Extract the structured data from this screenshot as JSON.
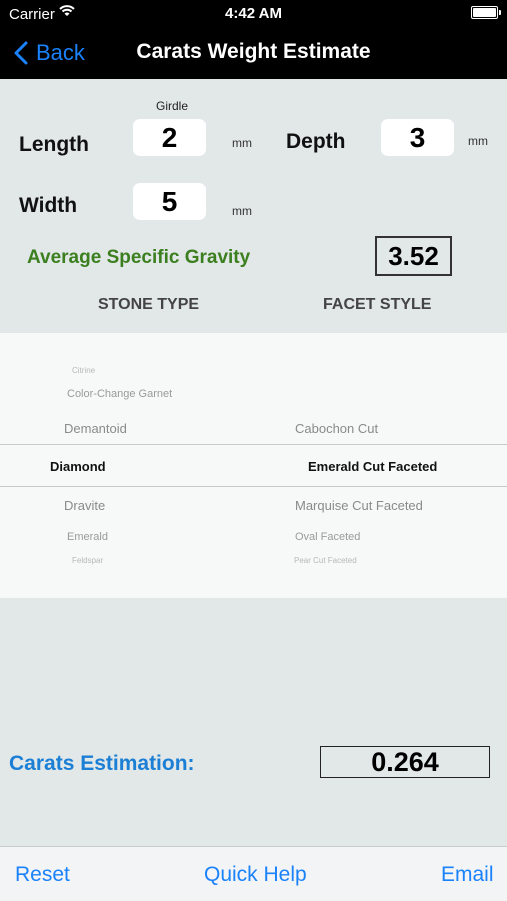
{
  "status_bar": {
    "carrier": "Carrier",
    "time": "4:42 AM"
  },
  "nav": {
    "back_label": "Back",
    "title": "Carats Weight Estimate"
  },
  "form": {
    "girdle_label": "Girdle",
    "length": {
      "label": "Length",
      "value": "2",
      "unit": "mm"
    },
    "depth": {
      "label": "Depth",
      "value": "3",
      "unit": "mm"
    },
    "width": {
      "label": "Width",
      "value": "5",
      "unit": "mm"
    },
    "specific_gravity": {
      "label": "Average Specific Gravity",
      "value": "3.52"
    }
  },
  "picker": {
    "stone_type_header": "STONE TYPE",
    "facet_style_header": "FACET STYLE",
    "stone_types": [
      "Citrine",
      "Color-Change Garnet",
      "Demantoid",
      "Diamond",
      "Dravite",
      "Emerald",
      "Feldspar"
    ],
    "stone_selected": "Diamond",
    "facet_styles": [
      "Cabochon Cut",
      "Emerald Cut Faceted",
      "Marquise Cut Faceted",
      "Oval Faceted",
      "Pear Cut Faceted"
    ],
    "facet_selected": "Emerald Cut Faceted"
  },
  "result": {
    "label": "Carats Estimation:",
    "value": "0.264"
  },
  "toolbar": {
    "reset": "Reset",
    "quick_help": "Quick Help",
    "email": "Email"
  },
  "colors": {
    "accent": "#1a82fb",
    "gravity_green": "#3b7f1f",
    "estimation_blue": "#1b7fd6"
  }
}
